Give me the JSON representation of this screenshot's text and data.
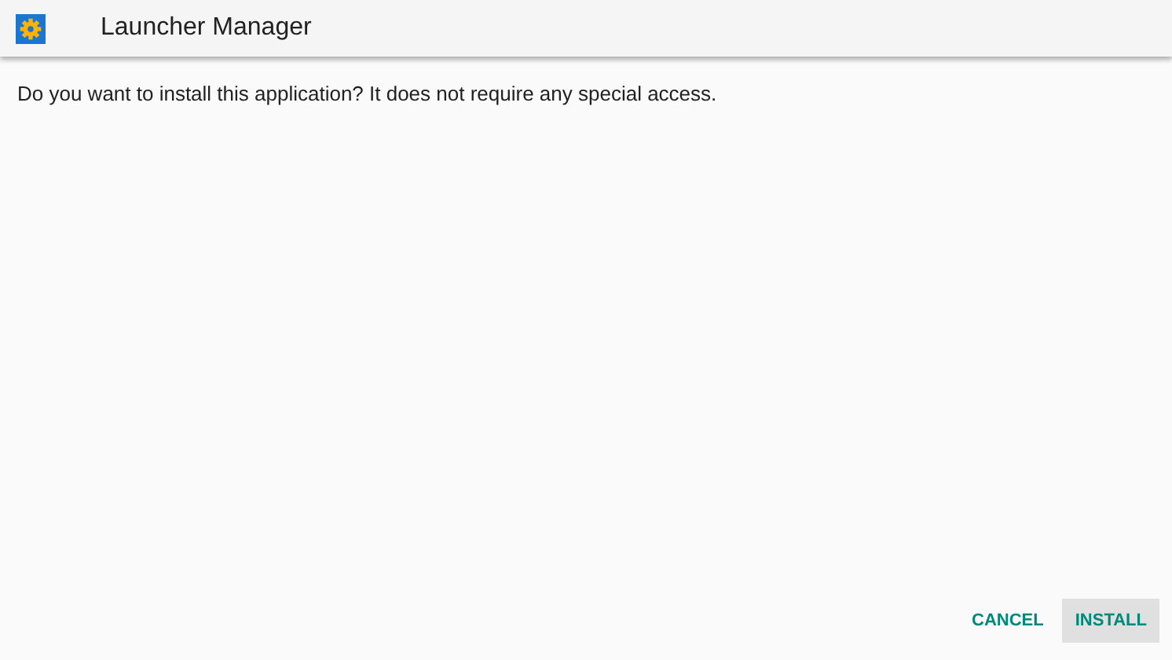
{
  "window": {
    "title": "Launcher Manager"
  },
  "message": "Do you want to install this application? It does not require any special access.",
  "buttons": [
    {
      "label": "CANCEL",
      "focused": false
    },
    {
      "label": "INSTALL",
      "focused": true
    }
  ]
}
